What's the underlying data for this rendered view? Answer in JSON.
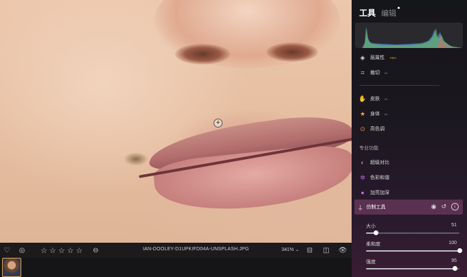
{
  "panel": {
    "tab_tools": "工具",
    "tab_edit": "编辑",
    "tools": [
      {
        "label": "层属性",
        "badge": "PRO"
      },
      {
        "label": "裁切",
        "badge": "AI"
      }
    ],
    "portrait": [
      {
        "label": "皮肤",
        "badge": "AI"
      },
      {
        "label": "身体",
        "badge": "AI"
      },
      {
        "label": "高色调"
      }
    ],
    "section_title": "专业功能",
    "pro": [
      {
        "label": "超级对比"
      },
      {
        "label": "色彩和谐"
      },
      {
        "label": "加亮加深"
      }
    ],
    "clone_tool": {
      "label": "仿制工具",
      "sliders": [
        {
          "label": "大小",
          "value": "51",
          "fraction": 0.1
        },
        {
          "label": "柔和度",
          "value": "100",
          "fraction": 1.0
        },
        {
          "label": "强度",
          "value": "95",
          "fraction": 0.95
        }
      ]
    }
  },
  "toolbar": {
    "filename": "IAN-DOOLEY-D1UPKIFD04A-UNSPLASH.JPG",
    "zoom": "341% ⌄",
    "rating": 0,
    "stars": [
      "☆",
      "☆",
      "☆",
      "☆",
      "☆"
    ]
  },
  "colors": {
    "accent": "#5b3151",
    "histogram_blue": "#5a8ec8",
    "histogram_green": "#6fc25a",
    "thumb_border": "#e1a84a"
  }
}
